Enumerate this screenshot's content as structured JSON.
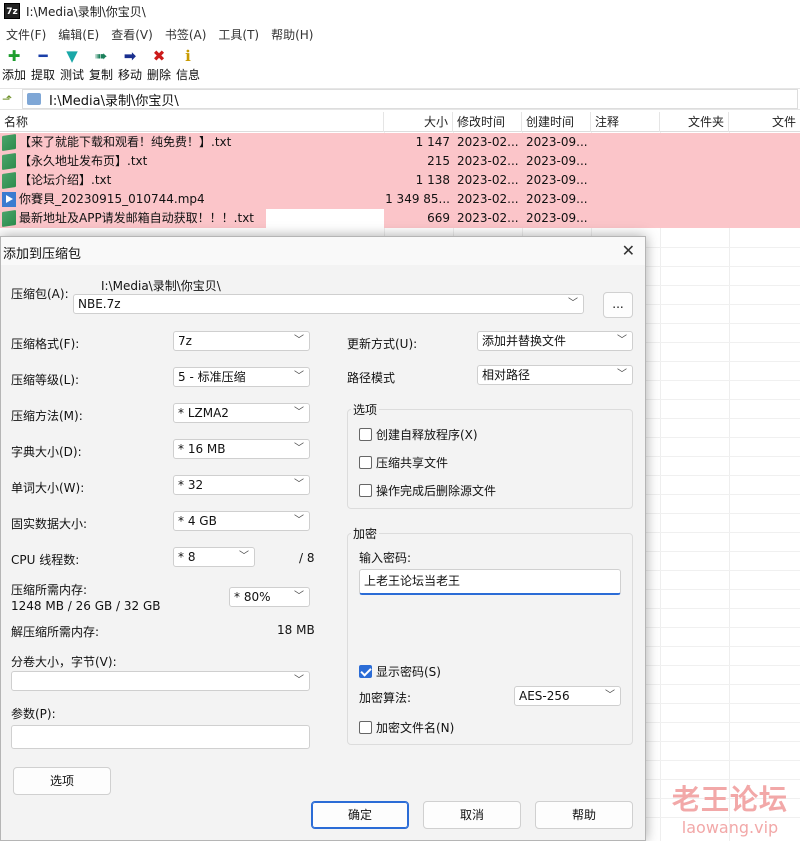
{
  "window": {
    "app_icon_text": "7z",
    "title": "I:\\Media\\录制\\你宝贝\\"
  },
  "menu": [
    "文件(F)",
    "编辑(E)",
    "查看(V)",
    "书签(A)",
    "工具(T)",
    "帮助(H)"
  ],
  "toolbar": [
    {
      "label": "添加",
      "icon": "plus-icon",
      "color": "#1e9e2e"
    },
    {
      "label": "提取",
      "icon": "minus-icon",
      "color": "#1a3fa8"
    },
    {
      "label": "测试",
      "icon": "check-icon",
      "color": "#1aa8a8"
    },
    {
      "label": "复制",
      "icon": "double-arrow-right-icon",
      "color": "#1a7f5a"
    },
    {
      "label": "移动",
      "icon": "arrow-right-icon",
      "color": "#1a2f8f"
    },
    {
      "label": "删除",
      "icon": "delete-x-icon",
      "color": "#cc1a1a"
    },
    {
      "label": "信息",
      "icon": "info-icon",
      "color": "#c89a00"
    }
  ],
  "address": {
    "path": "I:\\Media\\录制\\你宝贝\\"
  },
  "columns": [
    "名称",
    "大小",
    "修改时间",
    "创建时间",
    "注释",
    "文件夹",
    "文件"
  ],
  "files": [
    {
      "name": "【来了就能下载和观看！纯免费！】.txt",
      "size": "1 147",
      "modified": "2023-02...",
      "created": "2023-09...",
      "type": "txt"
    },
    {
      "name": "【永久地址发布页】.txt",
      "size": "215",
      "modified": "2023-02...",
      "created": "2023-09...",
      "type": "txt"
    },
    {
      "name": "【论坛介绍】.txt",
      "size": "1 138",
      "modified": "2023-02...",
      "created": "2023-09...",
      "type": "txt"
    },
    {
      "name": "你賽貝_20230915_010744.mp4",
      "size": "1 349 85...",
      "modified": "2023-02...",
      "created": "2023-09...",
      "type": "mp4"
    },
    {
      "name": "最新地址及APP请发邮箱自动获取！！！.txt",
      "size": "669",
      "modified": "2023-02...",
      "created": "2023-09...",
      "type": "txt"
    }
  ],
  "dialog": {
    "title": "添加到压缩包",
    "close": "✕",
    "archive_label": "压缩包(A):",
    "archive_dir": "I:\\Media\\录制\\你宝贝\\",
    "archive_name": "NBE.7z",
    "browse": "...",
    "format_label": "压缩格式(F):",
    "format_value": "7z",
    "level_label": "压缩等级(L):",
    "level_value": "5 - 标准压缩",
    "method_label": "压缩方法(M):",
    "method_value": "* LZMA2",
    "dict_label": "字典大小(D):",
    "dict_value": "* 16 MB",
    "word_label": "单词大小(W):",
    "word_value": "* 32",
    "solid_label": "固实数据大小:",
    "solid_value": "* 4 GB",
    "cpu_label": "CPU 线程数:",
    "cpu_value": "* 8",
    "cpu_total": "/ 8",
    "mem_label": "压缩所需内存:",
    "mem_detail": "1248 MB / 26 GB / 32 GB",
    "mem_value": "* 80%",
    "decomp_label": "解压缩所需内存:",
    "decomp_value": "18 MB",
    "split_label": "分卷大小，字节(V):",
    "split_value": "",
    "params_label": "参数(P):",
    "params_value": "",
    "options_button": "选项",
    "update_label": "更新方式(U):",
    "update_value": "添加并替换文件",
    "path_label": "路径模式",
    "path_value": "相对路径",
    "options_group": "选项",
    "opt_sfx": "创建自释放程序(X)",
    "opt_shared": "压缩共享文件",
    "opt_delete": "操作完成后删除源文件",
    "enc_group": "加密",
    "pw_label": "输入密码:",
    "pw_value": "上老王论坛当老王",
    "show_pw": "显示密码(S)",
    "enc_method_label": "加密算法:",
    "enc_method_value": "AES-256",
    "enc_names": "加密文件名(N)",
    "ok": "确定",
    "cancel": "取消",
    "help": "帮助"
  },
  "watermark": {
    "cn": "老王论坛",
    "en": "laowang.vip"
  }
}
